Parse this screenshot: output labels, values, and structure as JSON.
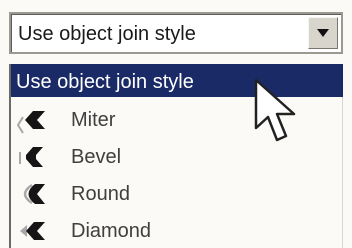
{
  "combo": {
    "value": "Use object join style",
    "arrow_icon": "chevron-down-icon"
  },
  "list": {
    "selected_label": "Use object join style",
    "items": [
      {
        "label": "Miter",
        "icon": "miter-join-icon"
      },
      {
        "label": "Bevel",
        "icon": "bevel-join-icon"
      },
      {
        "label": "Round",
        "icon": "round-join-icon"
      },
      {
        "label": "Diamond",
        "icon": "diamond-join-icon"
      }
    ]
  },
  "colors": {
    "highlight": "#1a2a66",
    "background": "#fbfaf6",
    "icon_dark": "#151515",
    "icon_light": "#a8a8a8"
  }
}
